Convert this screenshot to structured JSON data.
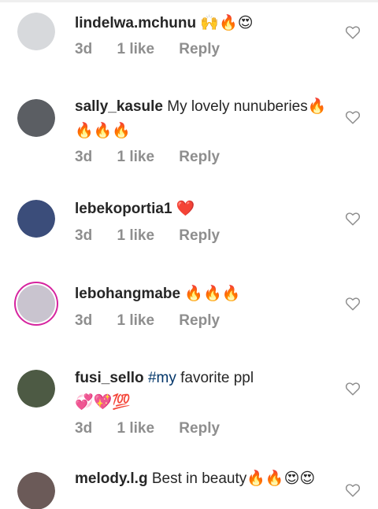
{
  "comments": [
    {
      "username": "lindelwa.mchunu",
      "text": "",
      "emoji": "🙌🔥😍",
      "age": "3d",
      "likes": "1 like",
      "reply": "Reply",
      "avatar_color": "#d7d9dc"
    },
    {
      "username": "sally_kasule",
      "text": "My lovely nunuberies",
      "emoji": "🔥🔥🔥🔥",
      "age": "3d",
      "likes": "1 like",
      "reply": "Reply",
      "avatar_color": "#5b5e63"
    },
    {
      "username": "lebekoportia1",
      "text": "",
      "emoji": "❤️",
      "age": "3d",
      "likes": "1 like",
      "reply": "Reply",
      "avatar_color": "#3b4d7a"
    },
    {
      "username": "lebohangmabe",
      "text": "",
      "emoji": "🔥🔥🔥",
      "age": "3d",
      "likes": "1 like",
      "reply": "Reply",
      "avatar_color": "#c9c4cf"
    },
    {
      "username": "fusi_sello",
      "hashtag": "#my",
      "text": "favorite ppl",
      "emoji": "💞💖💯",
      "age": "3d",
      "likes": "1 like",
      "reply": "Reply",
      "avatar_color": "#4d5a44"
    },
    {
      "username": "melody.l.g",
      "text": "Best in beauty",
      "emoji": "🔥🔥😍😍",
      "age": "",
      "likes": "",
      "reply": "",
      "avatar_color": "#6b5a58"
    }
  ]
}
